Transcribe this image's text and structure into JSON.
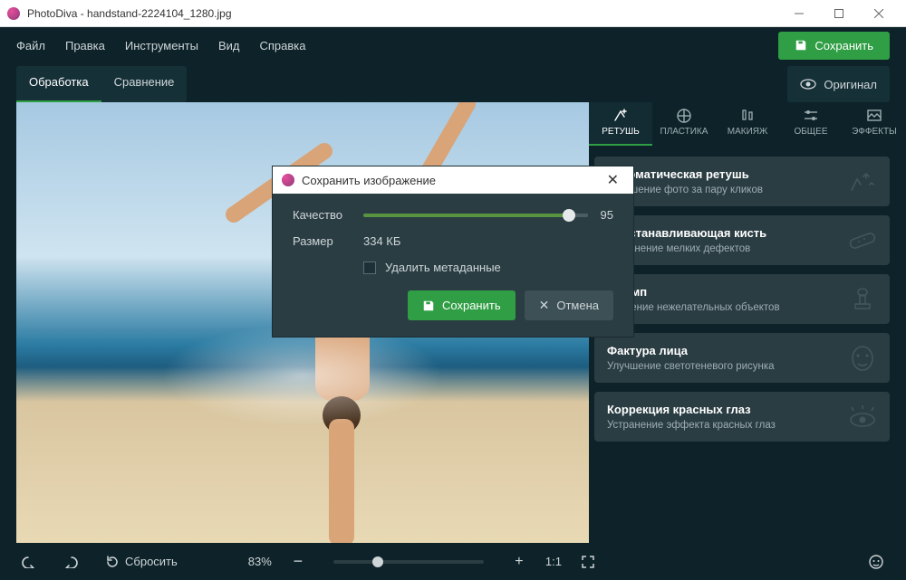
{
  "window": {
    "app_name": "PhotoDiva",
    "file_name": "handstand-2224104_1280.jpg"
  },
  "menu": {
    "items": [
      "Файл",
      "Правка",
      "Инструменты",
      "Вид",
      "Справка"
    ],
    "save_label": "Сохранить"
  },
  "subtabs": {
    "processing": "Обработка",
    "compare": "Сравнение",
    "original": "Оригинал"
  },
  "tool_tabs": [
    {
      "id": "retouch",
      "label": "РЕТУШЬ"
    },
    {
      "id": "plastic",
      "label": "ПЛАСТИКА"
    },
    {
      "id": "makeup",
      "label": "МАКИЯЖ"
    },
    {
      "id": "general",
      "label": "ОБЩЕЕ"
    },
    {
      "id": "effects",
      "label": "ЭФФЕКТЫ"
    }
  ],
  "cards": [
    {
      "title": "Автоматическая ретушь",
      "desc": "Улучшение фото за пару кликов"
    },
    {
      "title": "Восстанавливающая кисть",
      "desc": "Устранение мелких дефектов"
    },
    {
      "title": "Штамп",
      "desc": "Удаление нежелательных объектов"
    },
    {
      "title": "Фактура лица",
      "desc": "Улучшение светотеневого рисунка"
    },
    {
      "title": "Коррекция красных глаз",
      "desc": "Устранение эффекта красных глаз"
    }
  ],
  "bottombar": {
    "reset": "Сбросить",
    "zoom_pct": "83%",
    "ratio": "1:1"
  },
  "modal": {
    "title": "Сохранить изображение",
    "quality_label": "Качество",
    "quality_value": "95",
    "size_label": "Размер",
    "size_value": "334 КБ",
    "delete_meta": "Удалить метаданные",
    "save": "Сохранить",
    "cancel": "Отмена"
  }
}
